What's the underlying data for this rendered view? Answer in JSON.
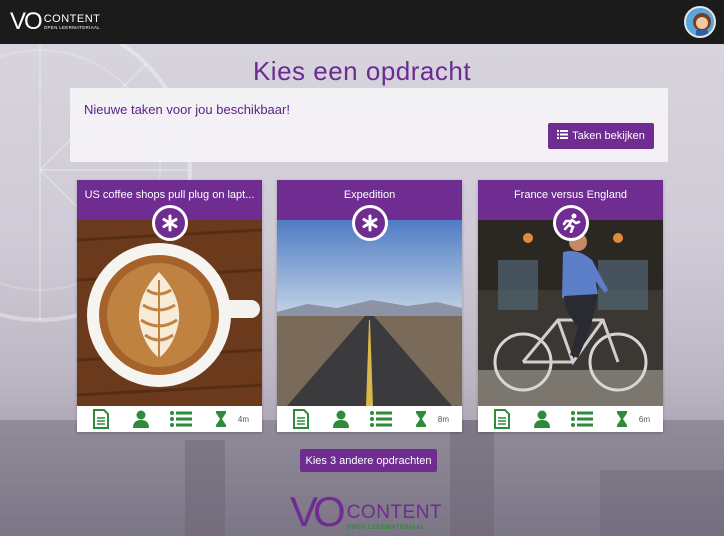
{
  "header": {
    "logo_vo": "VO",
    "logo_content": "CONTENT",
    "logo_tagline": "OPEN LEERMATERIAAL"
  },
  "page": {
    "title": "Kies een opdracht"
  },
  "notice": {
    "text": "Nieuwe taken voor jou beschikbaar!",
    "button_label": "Taken bekijken"
  },
  "cards": [
    {
      "title": "US coffee shops pull plug on lapt...",
      "badge_icon": "asterisk-icon",
      "image": "latte-art-coffee",
      "duration": "4m"
    },
    {
      "title": "Expedition",
      "badge_icon": "asterisk-icon",
      "image": "desert-road",
      "duration": "8m"
    },
    {
      "title": "France versus England",
      "badge_icon": "running-person-icon",
      "image": "cyclist-street",
      "duration": "6m"
    }
  ],
  "footer_icons": [
    "document-icon",
    "person-icon",
    "list-icon",
    "hourglass-icon"
  ],
  "other_button_label": "Kies 3 andere opdrachten",
  "footer_logo": {
    "vo": "VO",
    "content": "CONTENT",
    "tagline": "OPEN LEERMATERIAAL"
  },
  "colors": {
    "brand_purple": "#6f2c91",
    "icon_green": "#2e8b3a",
    "topbar": "#1b1b1b"
  }
}
